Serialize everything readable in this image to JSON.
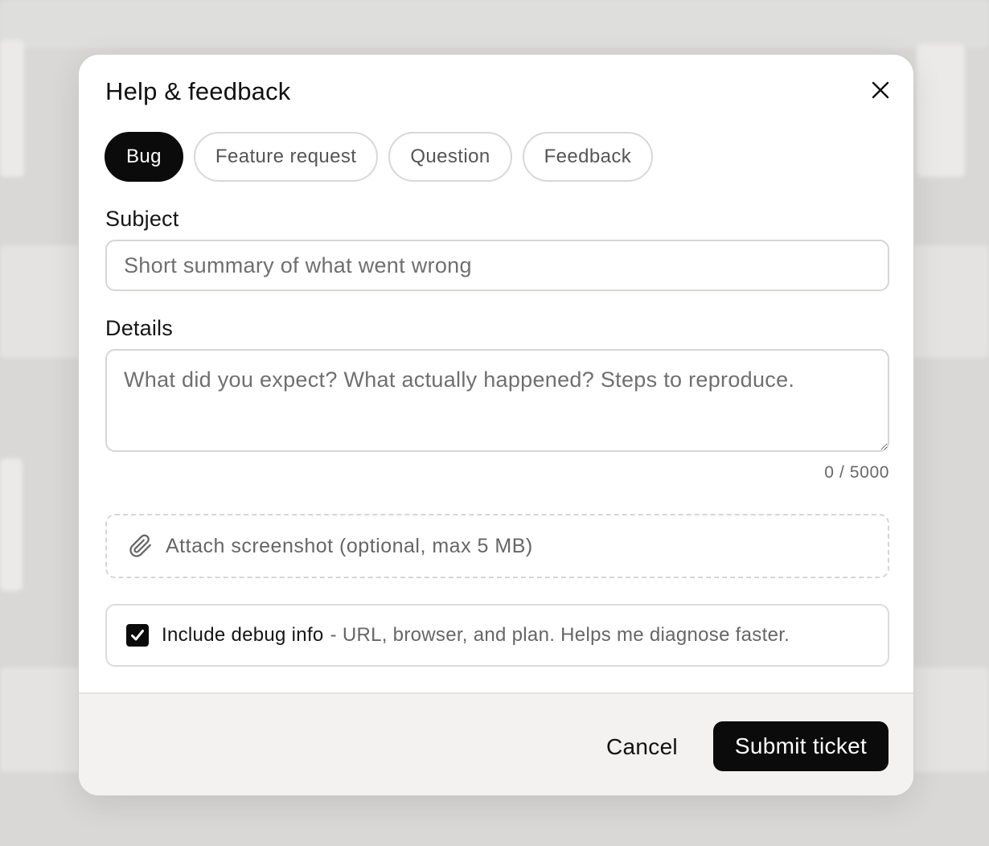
{
  "dialog": {
    "title": "Help & feedback"
  },
  "tabs": [
    {
      "label": "Bug",
      "active": true
    },
    {
      "label": "Feature request",
      "active": false
    },
    {
      "label": "Question",
      "active": false
    },
    {
      "label": "Feedback",
      "active": false
    }
  ],
  "subject": {
    "label": "Subject",
    "placeholder": "Short summary of what went wrong",
    "value": ""
  },
  "details": {
    "label": "Details",
    "placeholder": "What did you expect? What actually happened? Steps to reproduce.",
    "value": "",
    "counter": "0 / 5000"
  },
  "attachment": {
    "icon": "paperclip-icon",
    "label": "Attach screenshot (optional, max 5 MB)"
  },
  "debug": {
    "checked": true,
    "label": "Include debug info",
    "description": "- URL, browser, and plan. Helps me diagnose faster."
  },
  "footer": {
    "cancel_label": "Cancel",
    "submit_label": "Submit ticket"
  },
  "colors": {
    "primary": "#0b0b0b",
    "backdrop": "#d9d8d6",
    "footer_bg": "#f3f2f0"
  }
}
